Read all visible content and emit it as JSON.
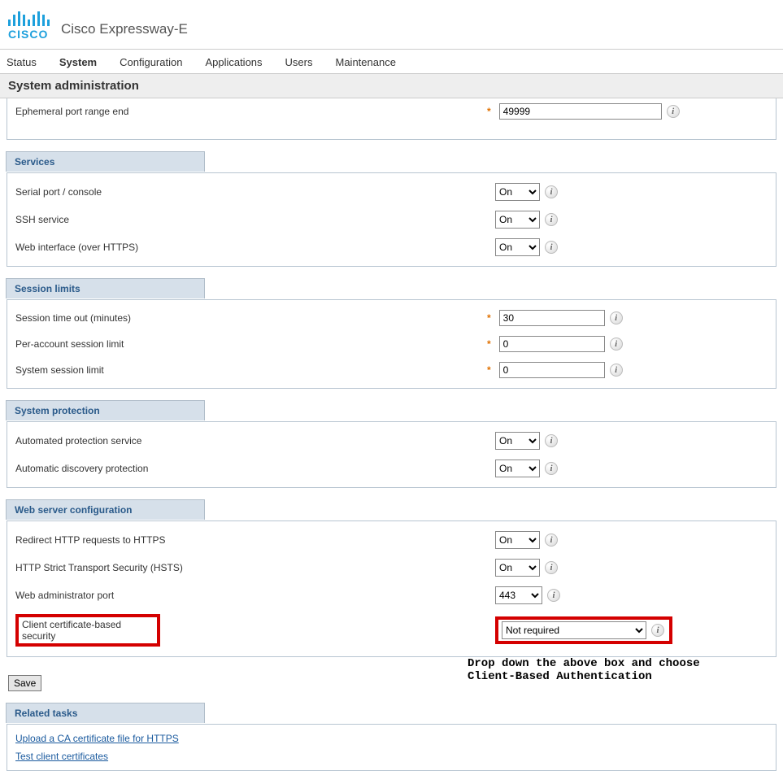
{
  "header": {
    "brand_text": "CISCO",
    "product": "Cisco Expressway-E"
  },
  "nav": {
    "items": [
      "Status",
      "System",
      "Configuration",
      "Applications",
      "Users",
      "Maintenance"
    ],
    "active_index": 1
  },
  "page_title": "System administration",
  "top_row": {
    "label": "Ephemeral port range end",
    "value": "49999"
  },
  "services": {
    "header": "Services",
    "rows": [
      {
        "label": "Serial port / console",
        "value": "On"
      },
      {
        "label": "SSH service",
        "value": "On"
      },
      {
        "label": "Web interface (over HTTPS)",
        "value": "On"
      }
    ]
  },
  "session_limits": {
    "header": "Session limits",
    "rows": [
      {
        "label": "Session time out (minutes)",
        "value": "30"
      },
      {
        "label": "Per-account session limit",
        "value": "0"
      },
      {
        "label": "System session limit",
        "value": "0"
      }
    ]
  },
  "system_protection": {
    "header": "System protection",
    "rows": [
      {
        "label": "Automated protection service",
        "value": "On"
      },
      {
        "label": "Automatic discovery protection",
        "value": "On"
      }
    ]
  },
  "web_server": {
    "header": "Web server configuration",
    "rows": [
      {
        "label": "Redirect HTTP requests to HTTPS",
        "value": "On"
      },
      {
        "label": "HTTP Strict Transport Security (HSTS)",
        "value": "On"
      },
      {
        "label": "Web administrator port",
        "value": "443"
      },
      {
        "label": "Client certificate-based security",
        "value": "Not required"
      }
    ]
  },
  "save_label": "Save",
  "annotation_text": "Drop down the above box and choose\nClient-Based Authentication",
  "related_tasks": {
    "header": "Related tasks",
    "links": [
      "Upload a CA certificate file for HTTPS",
      "Test client certificates"
    ]
  },
  "info_glyph": "i",
  "required_glyph": "*"
}
